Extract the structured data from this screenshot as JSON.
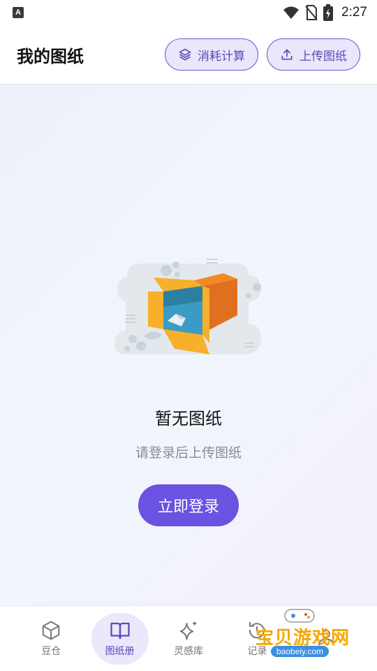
{
  "status_bar": {
    "time": "2:27",
    "notification_icon": "a-icon",
    "icons": [
      "wifi-icon",
      "no-sim-icon",
      "battery-charging-icon"
    ]
  },
  "header": {
    "title": "我的图纸",
    "actions": [
      {
        "label": "消耗计算",
        "icon": "layers-icon"
      },
      {
        "label": "上传图纸",
        "icon": "upload-icon"
      }
    ]
  },
  "empty_state": {
    "title": "暂无图纸",
    "subtitle": "请登录后上传图纸",
    "login_label": "立即登录",
    "illustration": "empty-box-illustration"
  },
  "bottom_nav": {
    "items": [
      {
        "label": "豆仓",
        "icon": "cube-icon",
        "active": false
      },
      {
        "label": "图纸册",
        "icon": "book-icon",
        "active": true
      },
      {
        "label": "灵感库",
        "icon": "sparkle-icon",
        "active": false
      },
      {
        "label": "记录",
        "icon": "history-icon",
        "active": false
      },
      {
        "label": "",
        "icon": "profile-icon",
        "active": false
      }
    ]
  },
  "watermark": {
    "text": "宝贝游戏网",
    "url": "baobeiy.com"
  },
  "colors": {
    "accent": "#6b52e0",
    "accent_light": "#ebe6fb",
    "background_gradient_start": "#eef0fa",
    "background_gradient_end": "#f2f0fb"
  }
}
